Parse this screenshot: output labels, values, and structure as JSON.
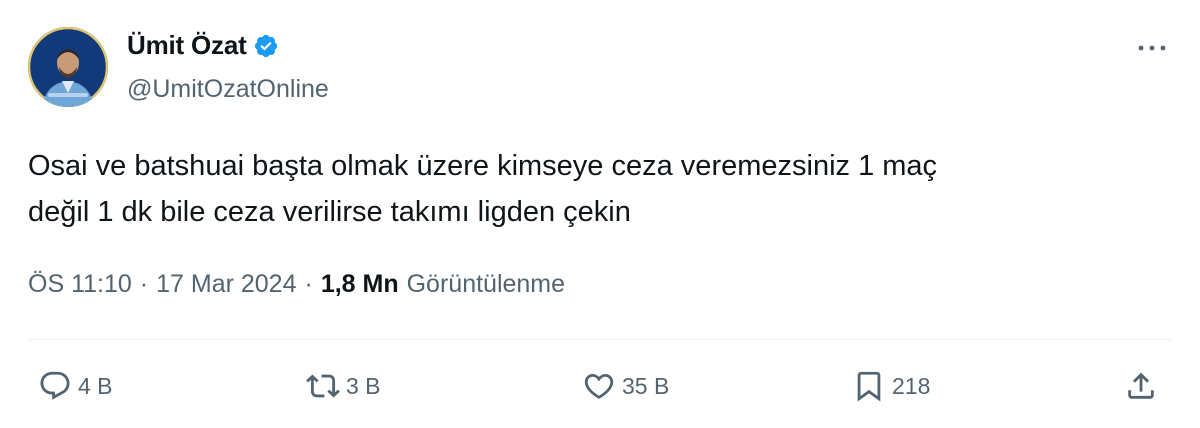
{
  "author": {
    "display_name": "Ümit Özat",
    "handle": "@UmitOzatOnline",
    "verified": true
  },
  "tweet": {
    "text_line1": "Osai ve batshuai başta olmak üzere kimseye ceza veremezsiniz 1 maç",
    "text_line2": "değil 1 dk bile ceza verilirse takımı ligden çekin",
    "time": "ÖS 11:10",
    "date": "17 Mar 2024",
    "separator": "·",
    "views_count": "1,8 Mn",
    "views_label": "Görüntülenme"
  },
  "actions": {
    "replies": "4 B",
    "retweets": "3 B",
    "likes": "35 B",
    "bookmarks": "218"
  },
  "colors": {
    "text_primary": "#0f1419",
    "text_secondary": "#536471",
    "verified_blue": "#1d9bf0",
    "divider": "#eff3f4"
  },
  "icons": [
    "verified-badge-icon",
    "more-options-icon",
    "reply-icon",
    "retweet-icon",
    "like-icon",
    "bookmark-icon",
    "share-icon"
  ]
}
